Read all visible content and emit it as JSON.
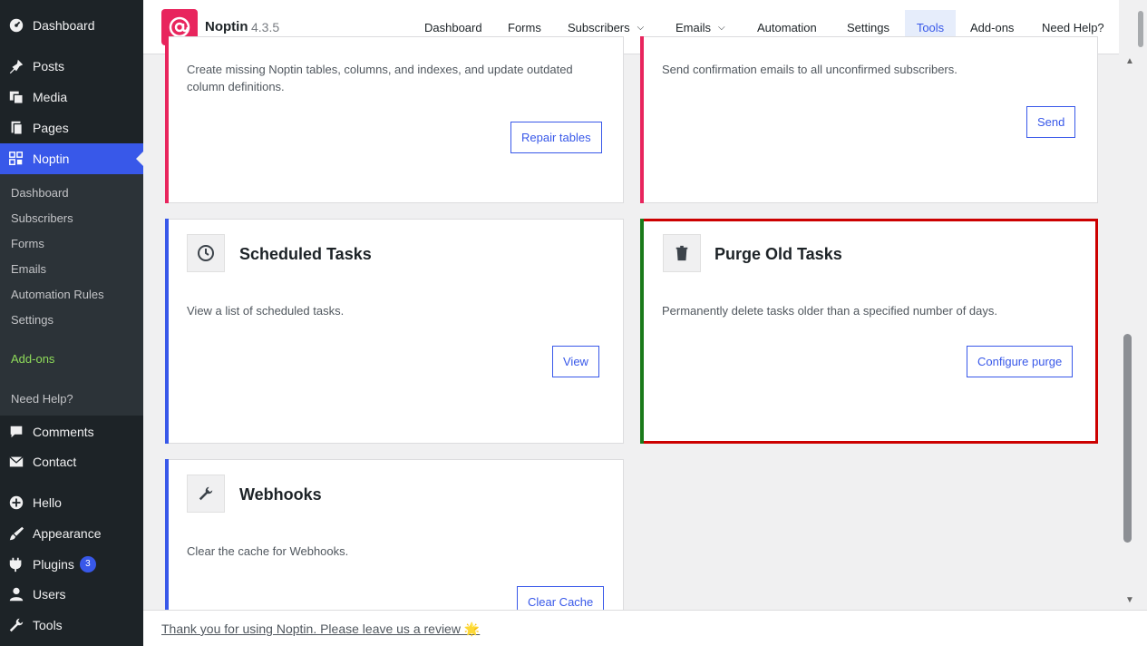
{
  "sidebar": {
    "top_items": [
      {
        "label": "Dashboard",
        "icon": "dashboard-icon"
      },
      {
        "label": "Posts",
        "icon": "pin-icon"
      },
      {
        "label": "Media",
        "icon": "media-icon"
      },
      {
        "label": "Pages",
        "icon": "pages-icon"
      },
      {
        "label": "Noptin",
        "icon": "grid-icon"
      }
    ],
    "submenu": [
      "Dashboard",
      "Subscribers",
      "Forms",
      "Emails",
      "Automation Rules",
      "Settings",
      "Add-ons",
      "Need Help?"
    ],
    "bottom_items": [
      {
        "label": "Comments",
        "icon": "comment-icon"
      },
      {
        "label": "Contact",
        "icon": "mail-icon"
      },
      {
        "label": "Hello",
        "icon": "plus-circle-icon"
      },
      {
        "label": "Appearance",
        "icon": "brush-icon"
      },
      {
        "label": "Plugins",
        "icon": "plugin-icon",
        "badge": "3"
      },
      {
        "label": "Users",
        "icon": "user-icon"
      },
      {
        "label": "Tools",
        "icon": "wrench-icon"
      }
    ]
  },
  "header": {
    "brand": "Noptin",
    "version": "4.3.5",
    "nav": [
      "Dashboard",
      "Forms",
      "Subscribers",
      "Emails",
      "Automation",
      "Settings",
      "Tools",
      "Add-ons",
      "Need Help?"
    ],
    "active_nav": "Tools"
  },
  "cards": {
    "repair": {
      "desc": "Create missing Noptin tables, columns, and indexes, and update outdated column definitions.",
      "button": "Repair tables",
      "accent": "#e8255d"
    },
    "confirm": {
      "desc": "Send confirmation emails to all unconfirmed subscribers.",
      "button": "Send",
      "accent": "#e8255d"
    },
    "scheduled": {
      "title": "Scheduled Tasks",
      "desc": "View a list of scheduled tasks.",
      "button": "View",
      "icon": "clock-icon",
      "accent": "#3858e9"
    },
    "purge": {
      "title": "Purge Old Tasks",
      "desc": "Permanently delete tasks older than a specified number of days.",
      "button": "Configure purge",
      "icon": "trash-icon",
      "accent": "#1a7a1a",
      "highlight": "#cc0000"
    },
    "webhooks": {
      "title": "Webhooks",
      "desc": "Clear the cache for Webhooks.",
      "button": "Clear Cache",
      "icon": "wrench-icon",
      "accent": "#3858e9"
    }
  },
  "footer": {
    "text": "Thank you for using Noptin. Please leave us a review 🌟"
  },
  "colors": {
    "sidebar_bg": "#1d2327",
    "active_blue": "#3858e9",
    "brand_pink": "#e8255d"
  }
}
